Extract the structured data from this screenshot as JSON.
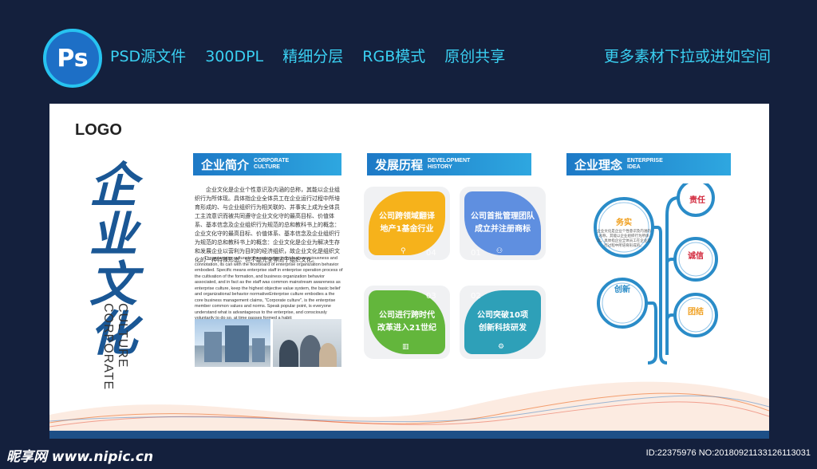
{
  "topbar": {
    "ps_label": "Ps",
    "items": [
      "PSD源文件",
      "300DPL",
      "精细分层",
      "RGB模式",
      "原创共享"
    ],
    "right_text": "更多素材下拉或进如空间"
  },
  "board": {
    "logo": "LOGO",
    "calligraphy": "企业文化",
    "corp_en_1": "CULTURE",
    "corp_en_2": "CORPORATE",
    "intro": {
      "title_cn": "企业简介",
      "title_en_1": "CORPORATE",
      "title_en_2": "CULTURE",
      "body_cn": "企业文化是企业个性意识及内涵的总称，其能以企业组织行为所体现。具体指企业全体员工在企业运行过程中所培育形成的、与企业组织行为相关联的、并事实上成为全体员工主流意识而被共同遵守企业文化守的最高目标、价值体系、基本信念及企业组织行为规范的总和教科书上的概念：企业文化守的最高目标、价值体系、基本信念及企业组织行为规范的总和教科书上的概念：企业文化是企业为解决生存和发展企业以营利为目的的经济组织，故企业文化是组织文化的一种特殊形态。但不能完全等同于组织文化。",
      "body_en": "The enterprise culture is the enterprise individual consciousness and connotation, its can with the floorboard of enterprise organization behavior embodied. Specific means enterprise staff in enterprise operation process of the cultivation of the formation, and business organization behavior associated, and in fact as the staff was common mainstream awareness as enterprise culture, keep the highest objective value system, the basic belief and organizational behavior normativeEnterprise culture embodies a the core business management claims, \"Corporate culture\", is the enterprise member common values and norms. Speak popular point, is everyone understand what is advantageous to the enterprise, and consciously voluntarily to do so, at time passes formed a habit;"
    },
    "history": {
      "title_cn": "发展历程",
      "title_en_1": "DEVELOPMENT",
      "title_en_2": "HISTORY",
      "cards": [
        {
          "text_1": "公司跨领域翻译",
          "text_2": "地产1基金行业",
          "num": "04",
          "color": "#f6b21b"
        },
        {
          "text_1": "公司首批管理团队",
          "text_2": "成立并注册商标",
          "num": "01",
          "color": "#5f8fe0"
        },
        {
          "text_1": "公司进行跨时代",
          "text_2": "改革进入21世纪",
          "num": "03",
          "color": "#63b63c"
        },
        {
          "text_1": "公司突破10项",
          "text_2": "创新科技研发",
          "num": "02",
          "color": "#2ea0b8"
        }
      ]
    },
    "concept": {
      "title_cn": "企业理念",
      "title_en_1": "ENTERPRISE",
      "title_en_2": "IDEA",
      "items": [
        {
          "title": "务实",
          "color": "#f0a020"
        },
        {
          "title": "责任",
          "color": "#d2283c"
        },
        {
          "title": "诚信",
          "color": "#d2283c"
        },
        {
          "title": "创新",
          "color": "#2a8cc8"
        },
        {
          "title": "团结",
          "color": "#f0a020"
        }
      ],
      "filler": "企业文化是企业个性意识及内涵的总称，其能以企业组织行为所体现。具体指企业全体员工在企业运行过程中所培育形成的。"
    }
  },
  "footer": {
    "left": "昵享网 www.nipic.cn",
    "right": "ID:22375976 NO:20180921133126113031"
  },
  "colors": {
    "background": "#14203d",
    "accent": "#3ad0f2",
    "header_blue": "#1d79c6"
  }
}
